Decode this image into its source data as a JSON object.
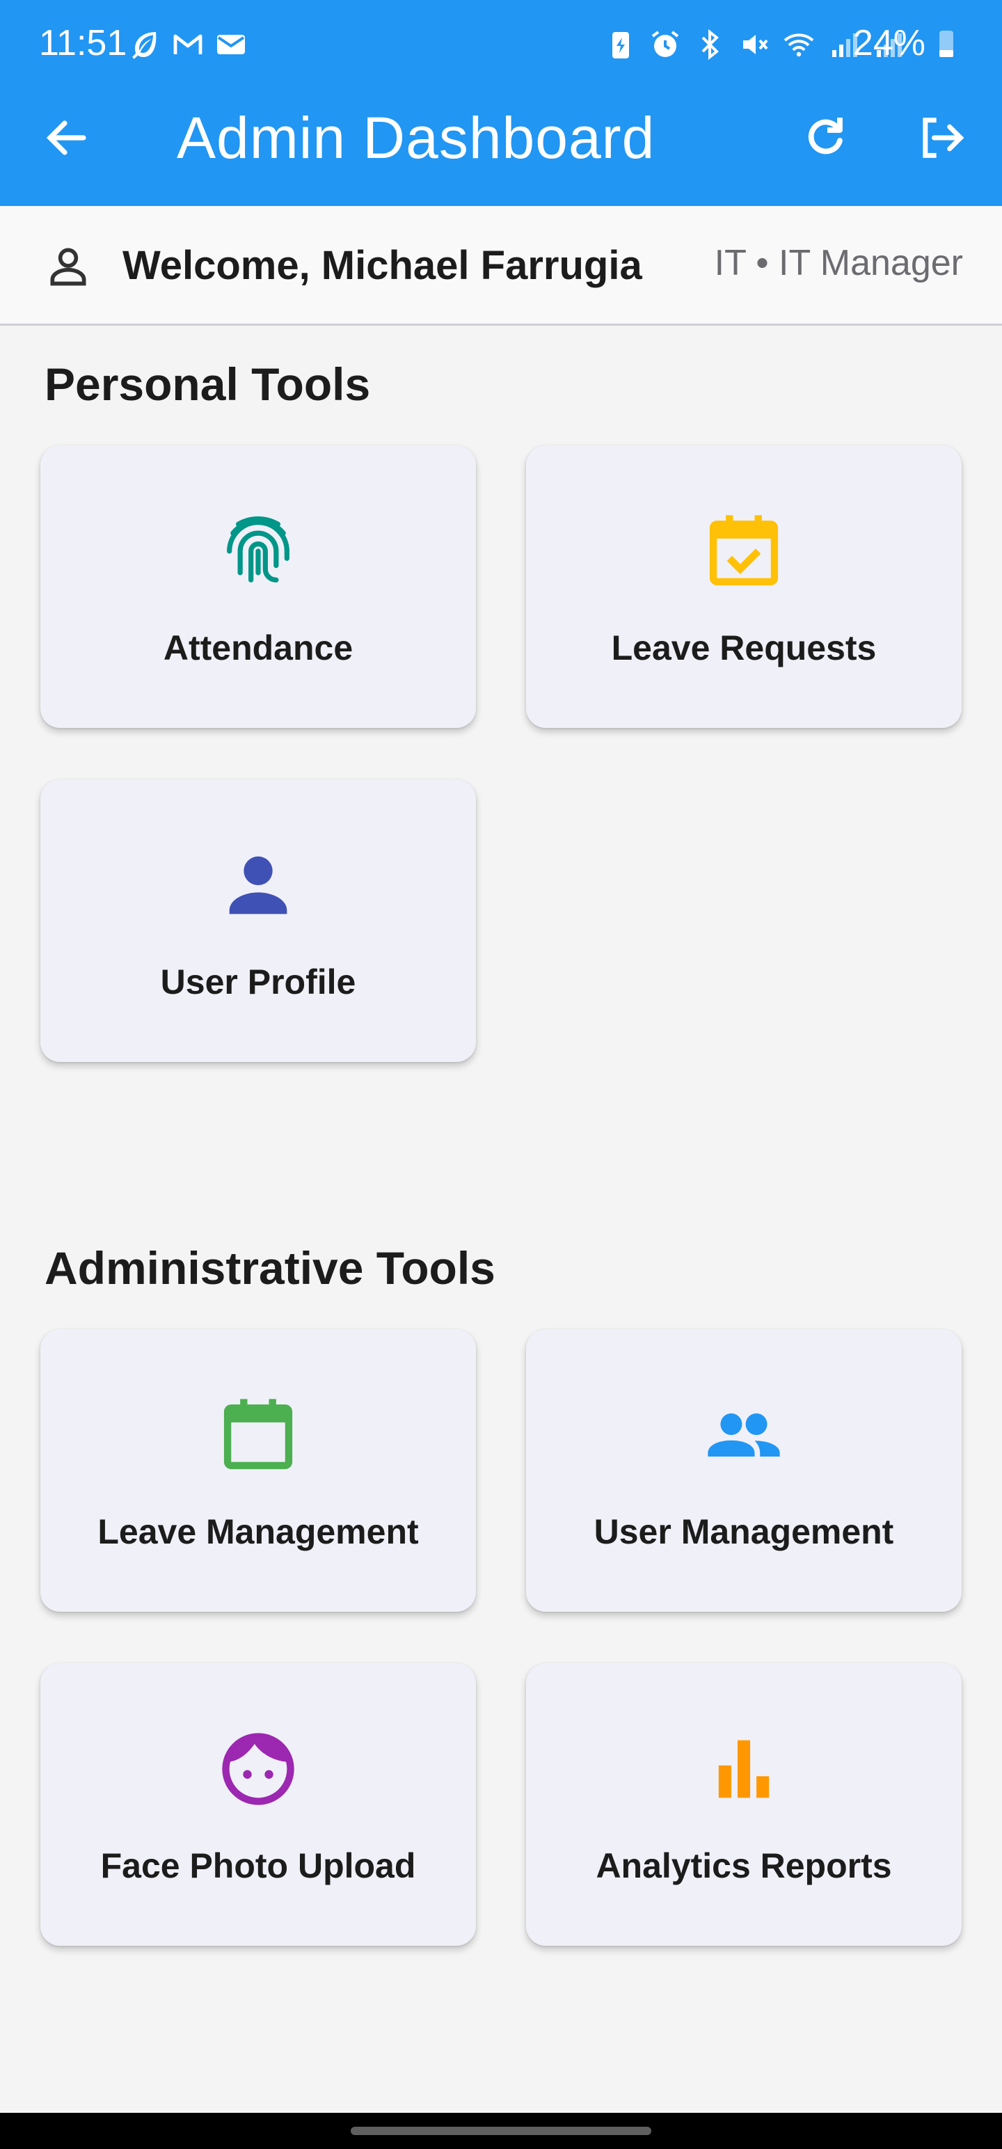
{
  "status_bar": {
    "time": "11:51",
    "battery_percent": "24%",
    "left_icons": [
      "leaf-icon",
      "gmail-icon",
      "mail-icon"
    ],
    "right_icons": [
      "battery-saver-icon",
      "alarm-icon",
      "bluetooth-icon",
      "mute-icon",
      "wifi-icon",
      "signal-icon",
      "signal-icon",
      "battery-icon"
    ]
  },
  "app_bar": {
    "title": "Admin Dashboard",
    "back_icon": "arrow-back-icon",
    "refresh_icon": "refresh-icon",
    "logout_icon": "logout-icon",
    "color": "#2196f3"
  },
  "welcome": {
    "greeting": "Welcome, Michael Farrugia",
    "role": "IT • IT Manager",
    "icon": "person-outline-icon"
  },
  "sections": {
    "personal": {
      "title": "Personal Tools",
      "cards": [
        {
          "label": "Attendance",
          "icon": "fingerprint-icon",
          "color": "#009688"
        },
        {
          "label": "Leave Requests",
          "icon": "event-available-icon",
          "color": "#ffc107"
        },
        {
          "label": "User Profile",
          "icon": "person-icon",
          "color": "#3f51b5"
        }
      ]
    },
    "admin": {
      "title": "Administrative Tools",
      "cards": [
        {
          "label": "Leave Management",
          "icon": "calendar-icon",
          "color": "#4caf50"
        },
        {
          "label": "User Management",
          "icon": "people-icon",
          "color": "#2196f3"
        },
        {
          "label": "Face Photo Upload",
          "icon": "face-icon",
          "color": "#9c27b0"
        },
        {
          "label": "Analytics Reports",
          "icon": "bar-chart-icon",
          "color": "#ff9800"
        }
      ]
    }
  }
}
